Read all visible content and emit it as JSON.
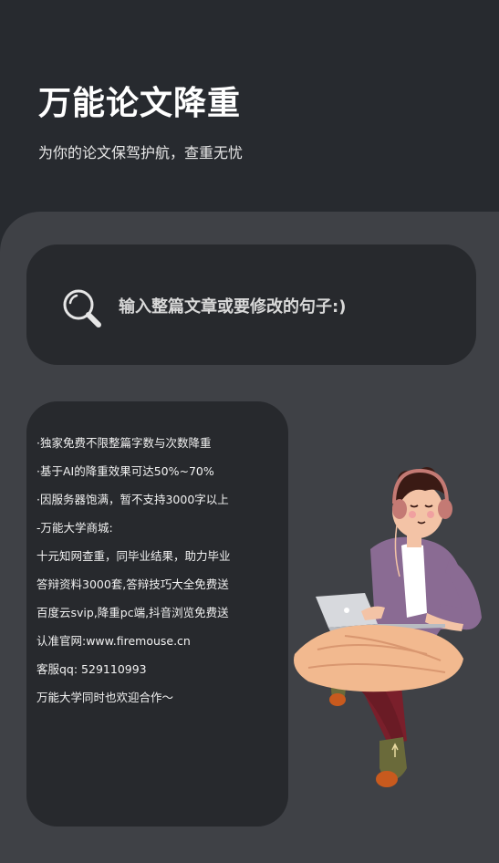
{
  "header": {
    "title": "万能论文降重",
    "subtitle": "为你的论文保驾护航，查重无忧"
  },
  "search": {
    "placeholder": "输入整篇文章或要修改的句子:)",
    "icon": "search-icon"
  },
  "info": {
    "lines": [
      "·独家免费不限整篇字数与次数降重",
      "·基于AI的降重效果可达50%~70%",
      "·因服务器饱满，暂不支持3000字以上",
      "-万能大学商城:",
      "十元知网查重，同毕业结果，助力毕业",
      "答辩资料3000套,答辩技巧大全免费送",
      "百度云svip,降重pc端,抖音浏览免费送",
      "认准官网:www.firemouse.cn",
      "客服qq: 529110993",
      "万能大学同时也欢迎合作～"
    ]
  },
  "illustration": {
    "icon": "person-with-laptop-illustration"
  },
  "colors": {
    "background": "#272a2f",
    "panel": "#3f4146",
    "card": "#27292d",
    "text": "#ffffff"
  }
}
